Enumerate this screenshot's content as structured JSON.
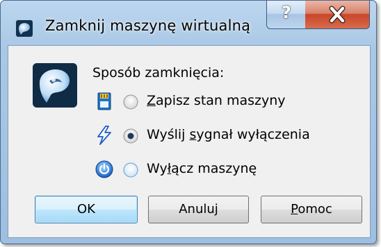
{
  "window": {
    "title": "Zamknij maszynę wirtualną",
    "help_glyph": "?",
    "app_icon": "virtualbox-icon"
  },
  "dialog": {
    "section_label": "Sposób zamknięcia:",
    "options": [
      {
        "mnemonic": "Z",
        "rest": "apisz stan maszyny",
        "icon": "save-state-icon",
        "selected": false
      },
      {
        "pre": "Wyślij ",
        "mnemonic": "s",
        "rest": "ygnał wyłączenia",
        "icon": "acpi-signal-icon",
        "selected": true
      },
      {
        "pre": "Wy",
        "mnemonic": "ł",
        "rest": "ącz maszynę",
        "icon": "power-off-icon",
        "selected": false
      }
    ]
  },
  "buttons": {
    "ok": "OK",
    "cancel": "Anuluj",
    "help_mnemonic": "P",
    "help_rest": "omoc"
  }
}
